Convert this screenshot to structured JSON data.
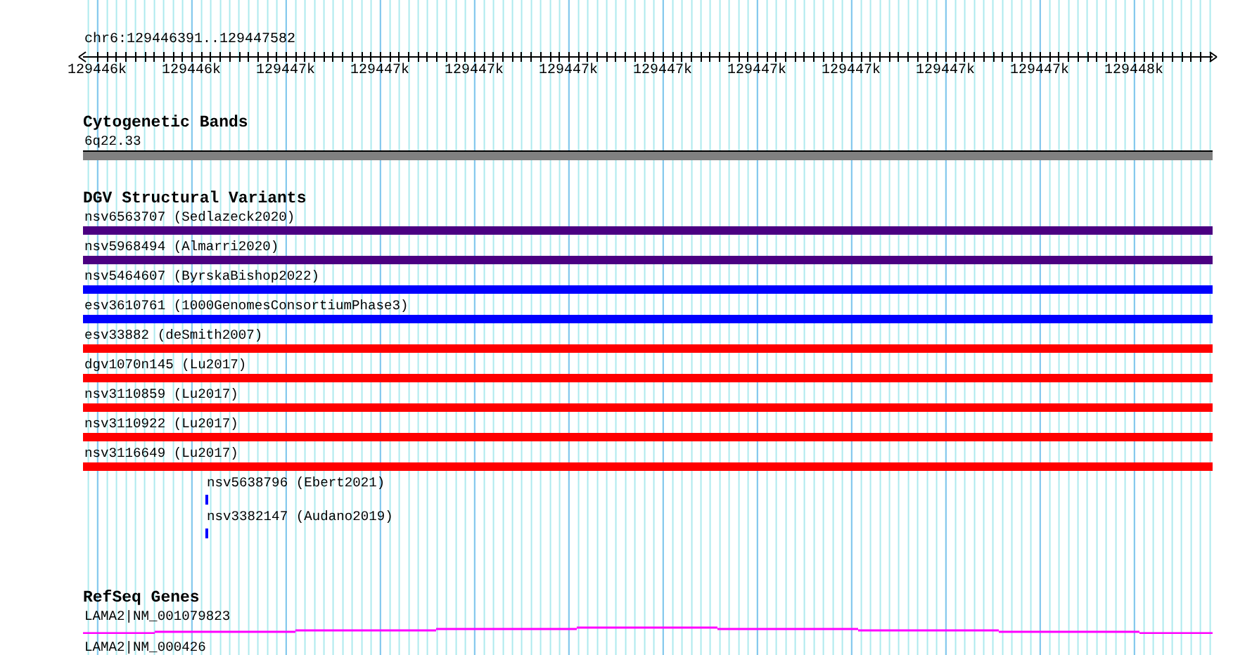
{
  "ruler": {
    "region": "chr6:129446391..129447582",
    "tick_labels": [
      "129446k",
      "129446k",
      "129447k",
      "129447k",
      "129447k",
      "129447k",
      "129447k",
      "129447k",
      "129447k",
      "129447k",
      "129447k",
      "129448k"
    ]
  },
  "tracks": [
    {
      "kind": "bands",
      "title": "Cytogenetic Bands",
      "features": [
        {
          "label": "6q22.33"
        }
      ]
    },
    {
      "kind": "variants",
      "title": "DGV Structural Variants",
      "features": [
        {
          "label": "nsv6563707 (Sedlazeck2020)",
          "kind": "full",
          "color": "#4b0082"
        },
        {
          "label": "nsv5968494 (Almarri2020)",
          "kind": "full",
          "color": "#4b0082"
        },
        {
          "label": "nsv5464607 (ByrskaBishop2022)",
          "kind": "full",
          "color": "#0000ff"
        },
        {
          "label": "esv3610761 (1000GenomesConsortiumPhase3)",
          "kind": "full",
          "color": "#0000ff"
        },
        {
          "label": "esv33882 (deSmith2007)",
          "kind": "full",
          "color": "#ff0000"
        },
        {
          "label": "dgv1070n145 (Lu2017)",
          "kind": "full",
          "color": "#ff0000"
        },
        {
          "label": "nsv3110859 (Lu2017)",
          "kind": "full",
          "color": "#ff0000"
        },
        {
          "label": "nsv3110922 (Lu2017)",
          "kind": "full",
          "color": "#ff0000"
        },
        {
          "label": "nsv3116649 (Lu2017)",
          "kind": "full",
          "color": "#ff0000"
        },
        {
          "label": "nsv5638796 (Ebert2021)",
          "kind": "short",
          "color": "#0000ff"
        },
        {
          "label": "nsv3382147 (Audano2019)",
          "kind": "short",
          "color": "#0000ff"
        }
      ]
    },
    {
      "kind": "genes",
      "title": "RefSeq Genes",
      "features": [
        {
          "label": "LAMA2|NM_001079823"
        },
        {
          "label": "LAMA2|NM_000426"
        }
      ]
    }
  ]
}
